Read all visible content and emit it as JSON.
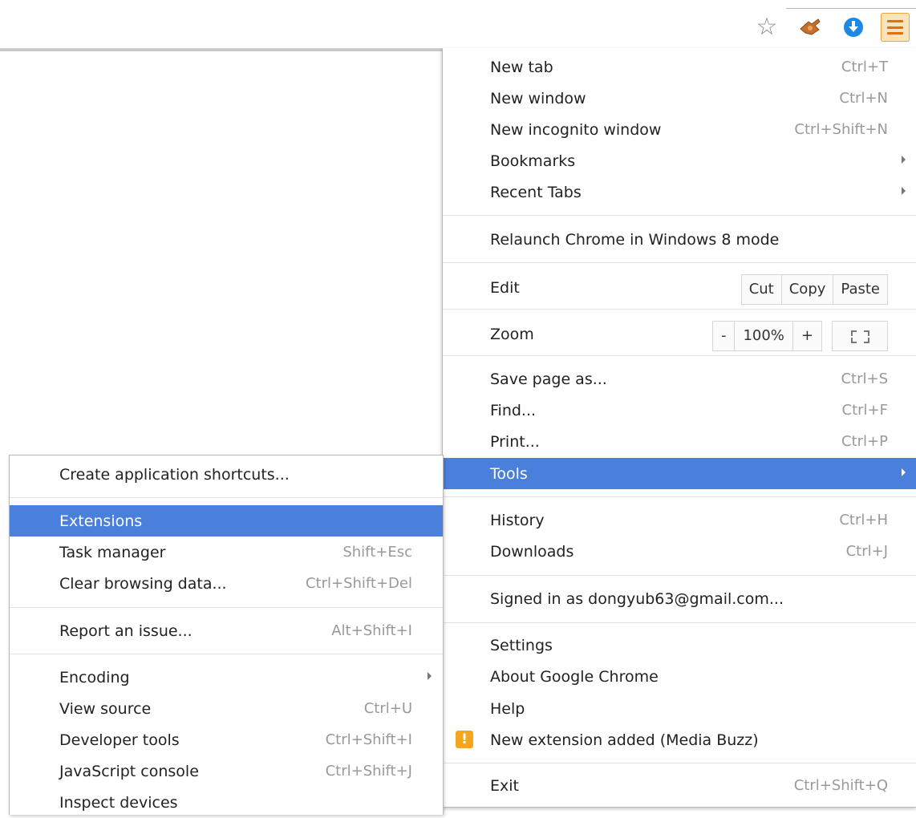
{
  "toolbar": {
    "star_glyph": "☆",
    "icons": [
      "bookmark-star-icon",
      "extension-icon",
      "download-icon",
      "chrome-menu-icon"
    ]
  },
  "colors": {
    "highlight": "#4a7fdc",
    "menu_button_bg": "#fbe5b8",
    "menu_button_bars": "#e07010",
    "warning": "#f4a71d",
    "download_icon": "#1e88e5"
  },
  "main_menu": {
    "new_tab": {
      "label": "New tab",
      "shortcut": "Ctrl+T"
    },
    "new_window": {
      "label": "New window",
      "shortcut": "Ctrl+N"
    },
    "new_incognito": {
      "label": "New incognito window",
      "shortcut": "Ctrl+Shift+N"
    },
    "bookmarks": {
      "label": "Bookmarks"
    },
    "recent_tabs": {
      "label": "Recent Tabs"
    },
    "relaunch": {
      "label": "Relaunch Chrome in Windows 8 mode"
    },
    "edit": {
      "label": "Edit",
      "cut": "Cut",
      "copy": "Copy",
      "paste": "Paste"
    },
    "zoom": {
      "label": "Zoom",
      "minus": "-",
      "level": "100%",
      "plus": "+"
    },
    "save_page": {
      "label": "Save page as...",
      "shortcut": "Ctrl+S"
    },
    "find": {
      "label": "Find...",
      "shortcut": "Ctrl+F"
    },
    "print": {
      "label": "Print...",
      "shortcut": "Ctrl+P"
    },
    "tools": {
      "label": "Tools"
    },
    "history": {
      "label": "History",
      "shortcut": "Ctrl+H"
    },
    "downloads": {
      "label": "Downloads",
      "shortcut": "Ctrl+J"
    },
    "signed_in": {
      "label": "Signed in as dongyub63@gmail.com..."
    },
    "settings": {
      "label": "Settings"
    },
    "about": {
      "label": "About Google Chrome"
    },
    "help": {
      "label": "Help"
    },
    "new_extension": {
      "label": "New extension added (Media Buzz)",
      "icon_glyph": "!"
    },
    "exit": {
      "label": "Exit",
      "shortcut": "Ctrl+Shift+Q"
    }
  },
  "tools_menu": {
    "create_shortcuts": {
      "label": "Create application shortcuts..."
    },
    "extensions": {
      "label": "Extensions"
    },
    "task_manager": {
      "label": "Task manager",
      "shortcut": "Shift+Esc"
    },
    "clear_data": {
      "label": "Clear browsing data...",
      "shortcut": "Ctrl+Shift+Del"
    },
    "report_issue": {
      "label": "Report an issue...",
      "shortcut": "Alt+Shift+I"
    },
    "encoding": {
      "label": "Encoding"
    },
    "view_source": {
      "label": "View source",
      "shortcut": "Ctrl+U"
    },
    "dev_tools": {
      "label": "Developer tools",
      "shortcut": "Ctrl+Shift+I"
    },
    "js_console": {
      "label": "JavaScript console",
      "shortcut": "Ctrl+Shift+J"
    },
    "inspect_devices": {
      "label": "Inspect devices"
    }
  }
}
